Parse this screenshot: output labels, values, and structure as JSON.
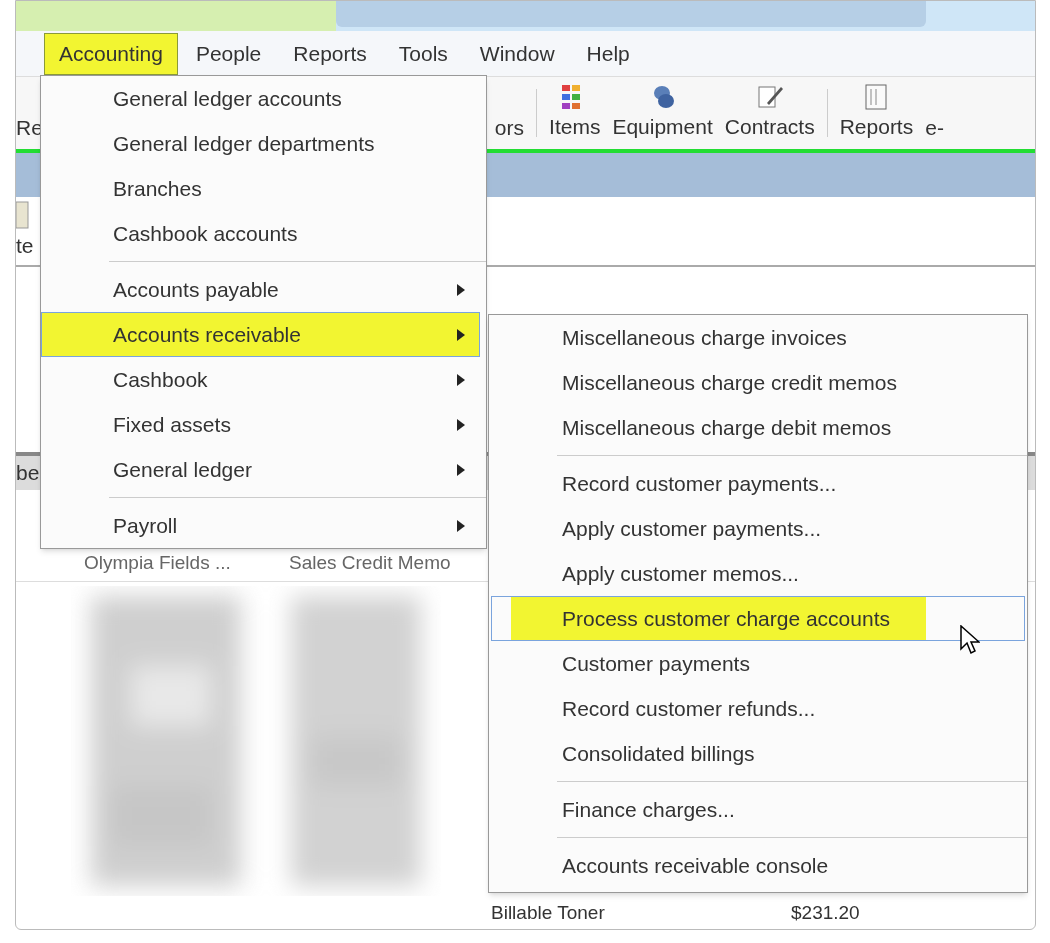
{
  "menubar": [
    {
      "label": "Accounting",
      "selected": true
    },
    {
      "label": "People",
      "selected": false
    },
    {
      "label": "Reports",
      "selected": false
    },
    {
      "label": "Tools",
      "selected": false
    },
    {
      "label": "Window",
      "selected": false
    },
    {
      "label": "Help",
      "selected": false
    }
  ],
  "toolbar": {
    "left_partial": "Re",
    "mid_partial": "ors",
    "buttons": [
      {
        "label": "Items"
      },
      {
        "label": "Equipment"
      },
      {
        "label": "Contracts"
      },
      {
        "label": "Reports"
      }
    ],
    "right_partial": "e-"
  },
  "second_toolbar": {
    "partial": "te"
  },
  "table": {
    "header_partial": "be",
    "rows": [
      {
        "column_1": "Olympia Fields ...",
        "column_2": "Sales Credit Memo"
      }
    ],
    "footer": {
      "column_1": "Billable Toner",
      "column_2": "$231.20"
    }
  },
  "accounting_menu": [
    {
      "kind": "item",
      "label": "General ledger accounts",
      "has_submenu": false,
      "selected": false
    },
    {
      "kind": "item",
      "label": "General ledger departments",
      "has_submenu": false,
      "selected": false
    },
    {
      "kind": "item",
      "label": "Branches",
      "has_submenu": false,
      "selected": false
    },
    {
      "kind": "item",
      "label": "Cashbook accounts",
      "has_submenu": false,
      "selected": false
    },
    {
      "kind": "separator"
    },
    {
      "kind": "item",
      "label": "Accounts payable",
      "has_submenu": true,
      "selected": false
    },
    {
      "kind": "item",
      "label": "Accounts receivable",
      "has_submenu": true,
      "selected": true
    },
    {
      "kind": "item",
      "label": "Cashbook",
      "has_submenu": true,
      "selected": false
    },
    {
      "kind": "item",
      "label": "Fixed assets",
      "has_submenu": true,
      "selected": false
    },
    {
      "kind": "item",
      "label": "General ledger",
      "has_submenu": true,
      "selected": false
    },
    {
      "kind": "separator"
    },
    {
      "kind": "item",
      "label": "Payroll",
      "has_submenu": true,
      "selected": false
    }
  ],
  "receivable_submenu": [
    {
      "kind": "item",
      "label": "Miscellaneous charge invoices",
      "selected": false
    },
    {
      "kind": "item",
      "label": "Miscellaneous charge credit memos",
      "selected": false
    },
    {
      "kind": "item",
      "label": "Miscellaneous charge debit memos",
      "selected": false
    },
    {
      "kind": "separator"
    },
    {
      "kind": "item",
      "label": "Record customer payments...",
      "selected": false
    },
    {
      "kind": "item",
      "label": "Apply customer payments...",
      "selected": false
    },
    {
      "kind": "item",
      "label": "Apply customer memos...",
      "selected": false
    },
    {
      "kind": "item",
      "label": "Process customer charge accounts",
      "selected": true
    },
    {
      "kind": "item",
      "label": "Customer payments",
      "selected": false
    },
    {
      "kind": "item",
      "label": "Record customer refunds...",
      "selected": false
    },
    {
      "kind": "item",
      "label": "Consolidated billings",
      "selected": false
    },
    {
      "kind": "separator"
    },
    {
      "kind": "item",
      "label": "Finance charges...",
      "selected": false
    },
    {
      "kind": "separator"
    },
    {
      "kind": "item",
      "label": "Accounts receivable console",
      "selected": false
    }
  ]
}
